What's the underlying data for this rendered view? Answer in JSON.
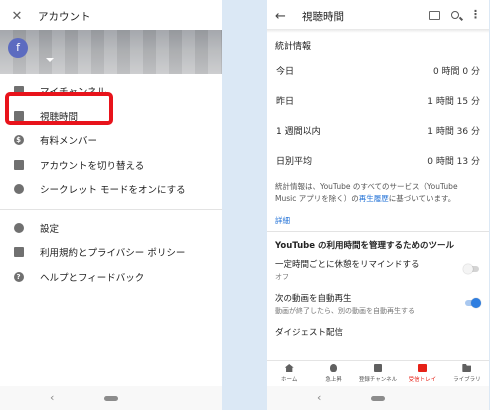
{
  "left": {
    "header": {
      "close_glyph": "✕",
      "title": "アカウント"
    },
    "avatar_letter": "f",
    "menu_primary": [
      {
        "icon": "person-box-icon",
        "label": "マイチャンネル"
      },
      {
        "icon": "bar-chart-icon",
        "label": "視聴時間"
      },
      {
        "icon": "dollar-circle-icon",
        "label": "有料メンバー"
      },
      {
        "icon": "switch-account-icon",
        "label": "アカウントを切り替える"
      },
      {
        "icon": "incognito-icon",
        "label": "シークレット モードをオンにする"
      }
    ],
    "menu_secondary": [
      {
        "icon": "gear-icon",
        "label": "設定"
      },
      {
        "icon": "lock-icon",
        "label": "利用規約とプライバシー ポリシー"
      },
      {
        "icon": "help-icon",
        "label": "ヘルプとフィードバック"
      }
    ],
    "highlight_color": "#e8131b"
  },
  "right": {
    "header": {
      "back_glyph": "←",
      "title": "視聴時間",
      "more_glyph": "⋮"
    },
    "stats_title": "統計情報",
    "stats": [
      {
        "label": "今日",
        "value": "0 時間 0 分"
      },
      {
        "label": "昨日",
        "value": "1 時間 15 分"
      },
      {
        "label": "1 週間以内",
        "value": "1 時間 36 分"
      },
      {
        "label": "日別平均",
        "value": "0 時間 13 分"
      }
    ],
    "note_part1": "統計情報は、YouTube のすべてのサービス（YouTube Music アプリを除く）の",
    "note_link": "再生履歴",
    "note_part2": "に基づいています。",
    "details_link": "詳細",
    "tools_title": "YouTube の利用時間を管理するためのツール",
    "toggles": [
      {
        "label": "一定時間ごとに休憩をリマインドする",
        "sub": "オフ",
        "state": "off"
      },
      {
        "label": "次の動画を自動再生",
        "sub": "動画が終了したら、別の動画を自動再生する",
        "state": "on"
      }
    ],
    "digest_label": "ダイジェスト配信",
    "tabs": [
      {
        "icon": "home-icon",
        "label": "ホーム"
      },
      {
        "icon": "trending-icon",
        "label": "急上昇"
      },
      {
        "icon": "subscriptions-icon",
        "label": "登録チャンネル"
      },
      {
        "icon": "inbox-icon",
        "label": "受信トレイ",
        "active": true
      },
      {
        "icon": "library-icon",
        "label": "ライブラリ"
      }
    ],
    "accent_color": "#2f7ee0",
    "brand_red": "#e62117"
  },
  "system_nav": {
    "back_glyph": "‹"
  }
}
